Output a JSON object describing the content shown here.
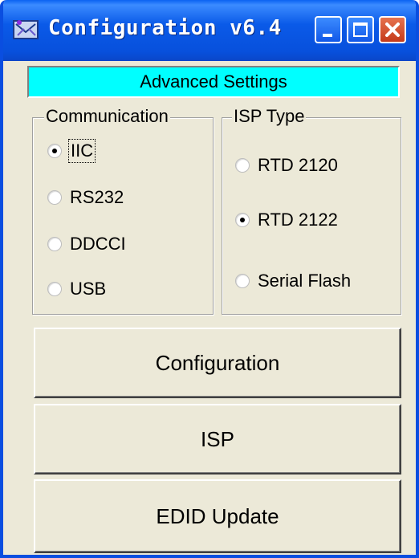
{
  "window": {
    "title": "Configuration v6.4",
    "icon": "app-icon",
    "controls": {
      "minimize": "minimize-icon",
      "maximize": "maximize-icon",
      "close": "close-icon"
    }
  },
  "banner": {
    "label": "Advanced Settings",
    "background": "#00ffff"
  },
  "communication": {
    "label": "Communication",
    "options": [
      {
        "label": "IIC",
        "selected": true
      },
      {
        "label": "RS232",
        "selected": false
      },
      {
        "label": "DDCCI",
        "selected": false
      },
      {
        "label": "USB",
        "selected": false
      }
    ]
  },
  "isp_type": {
    "label": "ISP Type",
    "options": [
      {
        "label": "RTD 2120",
        "selected": false
      },
      {
        "label": "RTD 2122",
        "selected": true
      },
      {
        "label": "Serial Flash",
        "selected": false
      }
    ]
  },
  "buttons": {
    "configuration": "Configuration",
    "isp": "ISP",
    "edid_update": "EDID Update"
  },
  "colors": {
    "titlebar": "#0a5ae8",
    "close": "#c43a1a",
    "face": "#ece9d8"
  }
}
